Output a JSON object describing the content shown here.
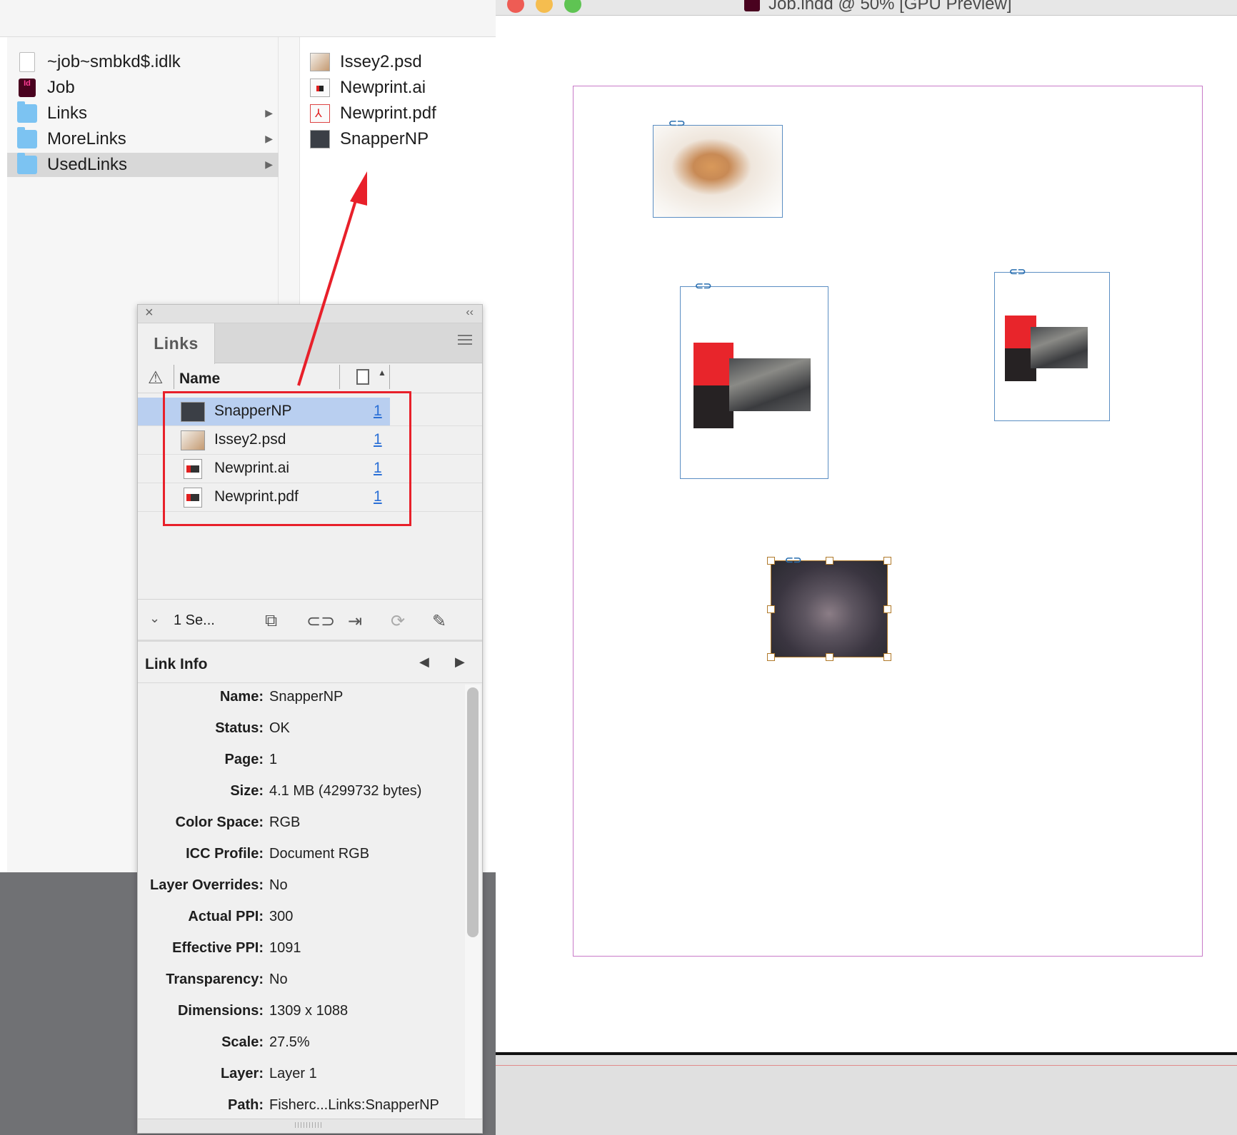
{
  "finder": {
    "sidebar_items": [
      {
        "label": "~job~smbkd$.idlk",
        "icon": "document-icon"
      },
      {
        "label": "Job",
        "icon": "indesign-file-icon"
      },
      {
        "label": "Links",
        "icon": "folder-icon"
      },
      {
        "label": "MoreLinks",
        "icon": "folder-icon"
      },
      {
        "label": "UsedLinks",
        "icon": "folder-icon",
        "selected": true
      }
    ],
    "files": [
      {
        "label": "Issey2.psd"
      },
      {
        "label": "Newprint.ai"
      },
      {
        "label": "Newprint.pdf"
      },
      {
        "label": "SnapperNP"
      }
    ]
  },
  "document_window": {
    "title": "Job.indd @ 50% [GPU Preview]",
    "traffic_lights": {
      "close": "#ee5c54",
      "minimize": "#f5bd4f",
      "zoom": "#5fc453"
    }
  },
  "links_panel": {
    "tab_label": "Links",
    "column_name": "Name",
    "links": [
      {
        "name": "SnapperNP",
        "page": "1",
        "selected": true
      },
      {
        "name": "Issey2.psd",
        "page": "1"
      },
      {
        "name": "Newprint.ai",
        "page": "1"
      },
      {
        "name": "Newprint.pdf",
        "page": "1"
      }
    ],
    "selection_summary": "1 Se...",
    "link_info_title": "Link Info",
    "link_info": [
      {
        "label": "Name:",
        "value": "SnapperNP"
      },
      {
        "label": "Status:",
        "value": "OK"
      },
      {
        "label": "Page:",
        "value": "1"
      },
      {
        "label": "Size:",
        "value": "4.1 MB (4299732 bytes)"
      },
      {
        "label": "Color Space:",
        "value": "RGB"
      },
      {
        "label": "ICC Profile:",
        "value": "Document RGB"
      },
      {
        "label": "Layer Overrides:",
        "value": "No"
      },
      {
        "label": "Actual PPI:",
        "value": "300"
      },
      {
        "label": "Effective PPI:",
        "value": "1091"
      },
      {
        "label": "Transparency:",
        "value": "No"
      },
      {
        "label": "Dimensions:",
        "value": "1309 x 1088"
      },
      {
        "label": "Scale:",
        "value": "27.5%"
      },
      {
        "label": "Layer:",
        "value": "Layer 1"
      },
      {
        "label": "Path:",
        "value": "Fisherc...Links:SnapperNP"
      }
    ]
  },
  "annotation_color": "#e8202a"
}
